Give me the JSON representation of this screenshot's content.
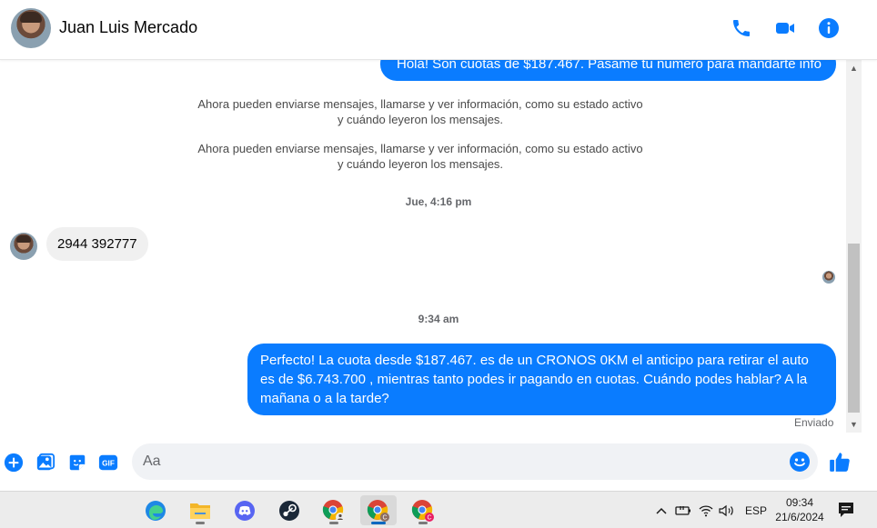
{
  "header": {
    "contact_name": "Juan Luis Mercado"
  },
  "messages": {
    "top_outgoing": "Hola! Son cuotas de $187.467. Pasame tu numero para mandarte info",
    "system_notes": [
      "Ahora pueden enviarse mensajes, llamarse y ver información, como su estado activo y cuándo leyeron los mensajes.",
      "Ahora pueden enviarse mensajes, llamarse y ver información, como su estado activo y cuándo leyeron los mensajes."
    ],
    "time_1": "Jue, 4:16 pm",
    "incoming_1": "2944 392777",
    "time_2": "9:34 am",
    "outgoing_2": "Perfecto! La cuota desde $187.467. es de un CRONOS 0KM el anticipo para retirar el auto es de $6.743.700 , mientras tanto podes ir pagando en cuotas. Cuándo podes hablar? A la mañana o a la tarde?",
    "status": "Enviado"
  },
  "composer": {
    "placeholder": "Aa",
    "gif_label": "GIF"
  },
  "taskbar": {
    "language": "ESP",
    "time": "09:34",
    "date": "21/6/2024"
  },
  "colors": {
    "accent": "#0a7cff",
    "incoming_bubble": "#f0f0f0"
  }
}
